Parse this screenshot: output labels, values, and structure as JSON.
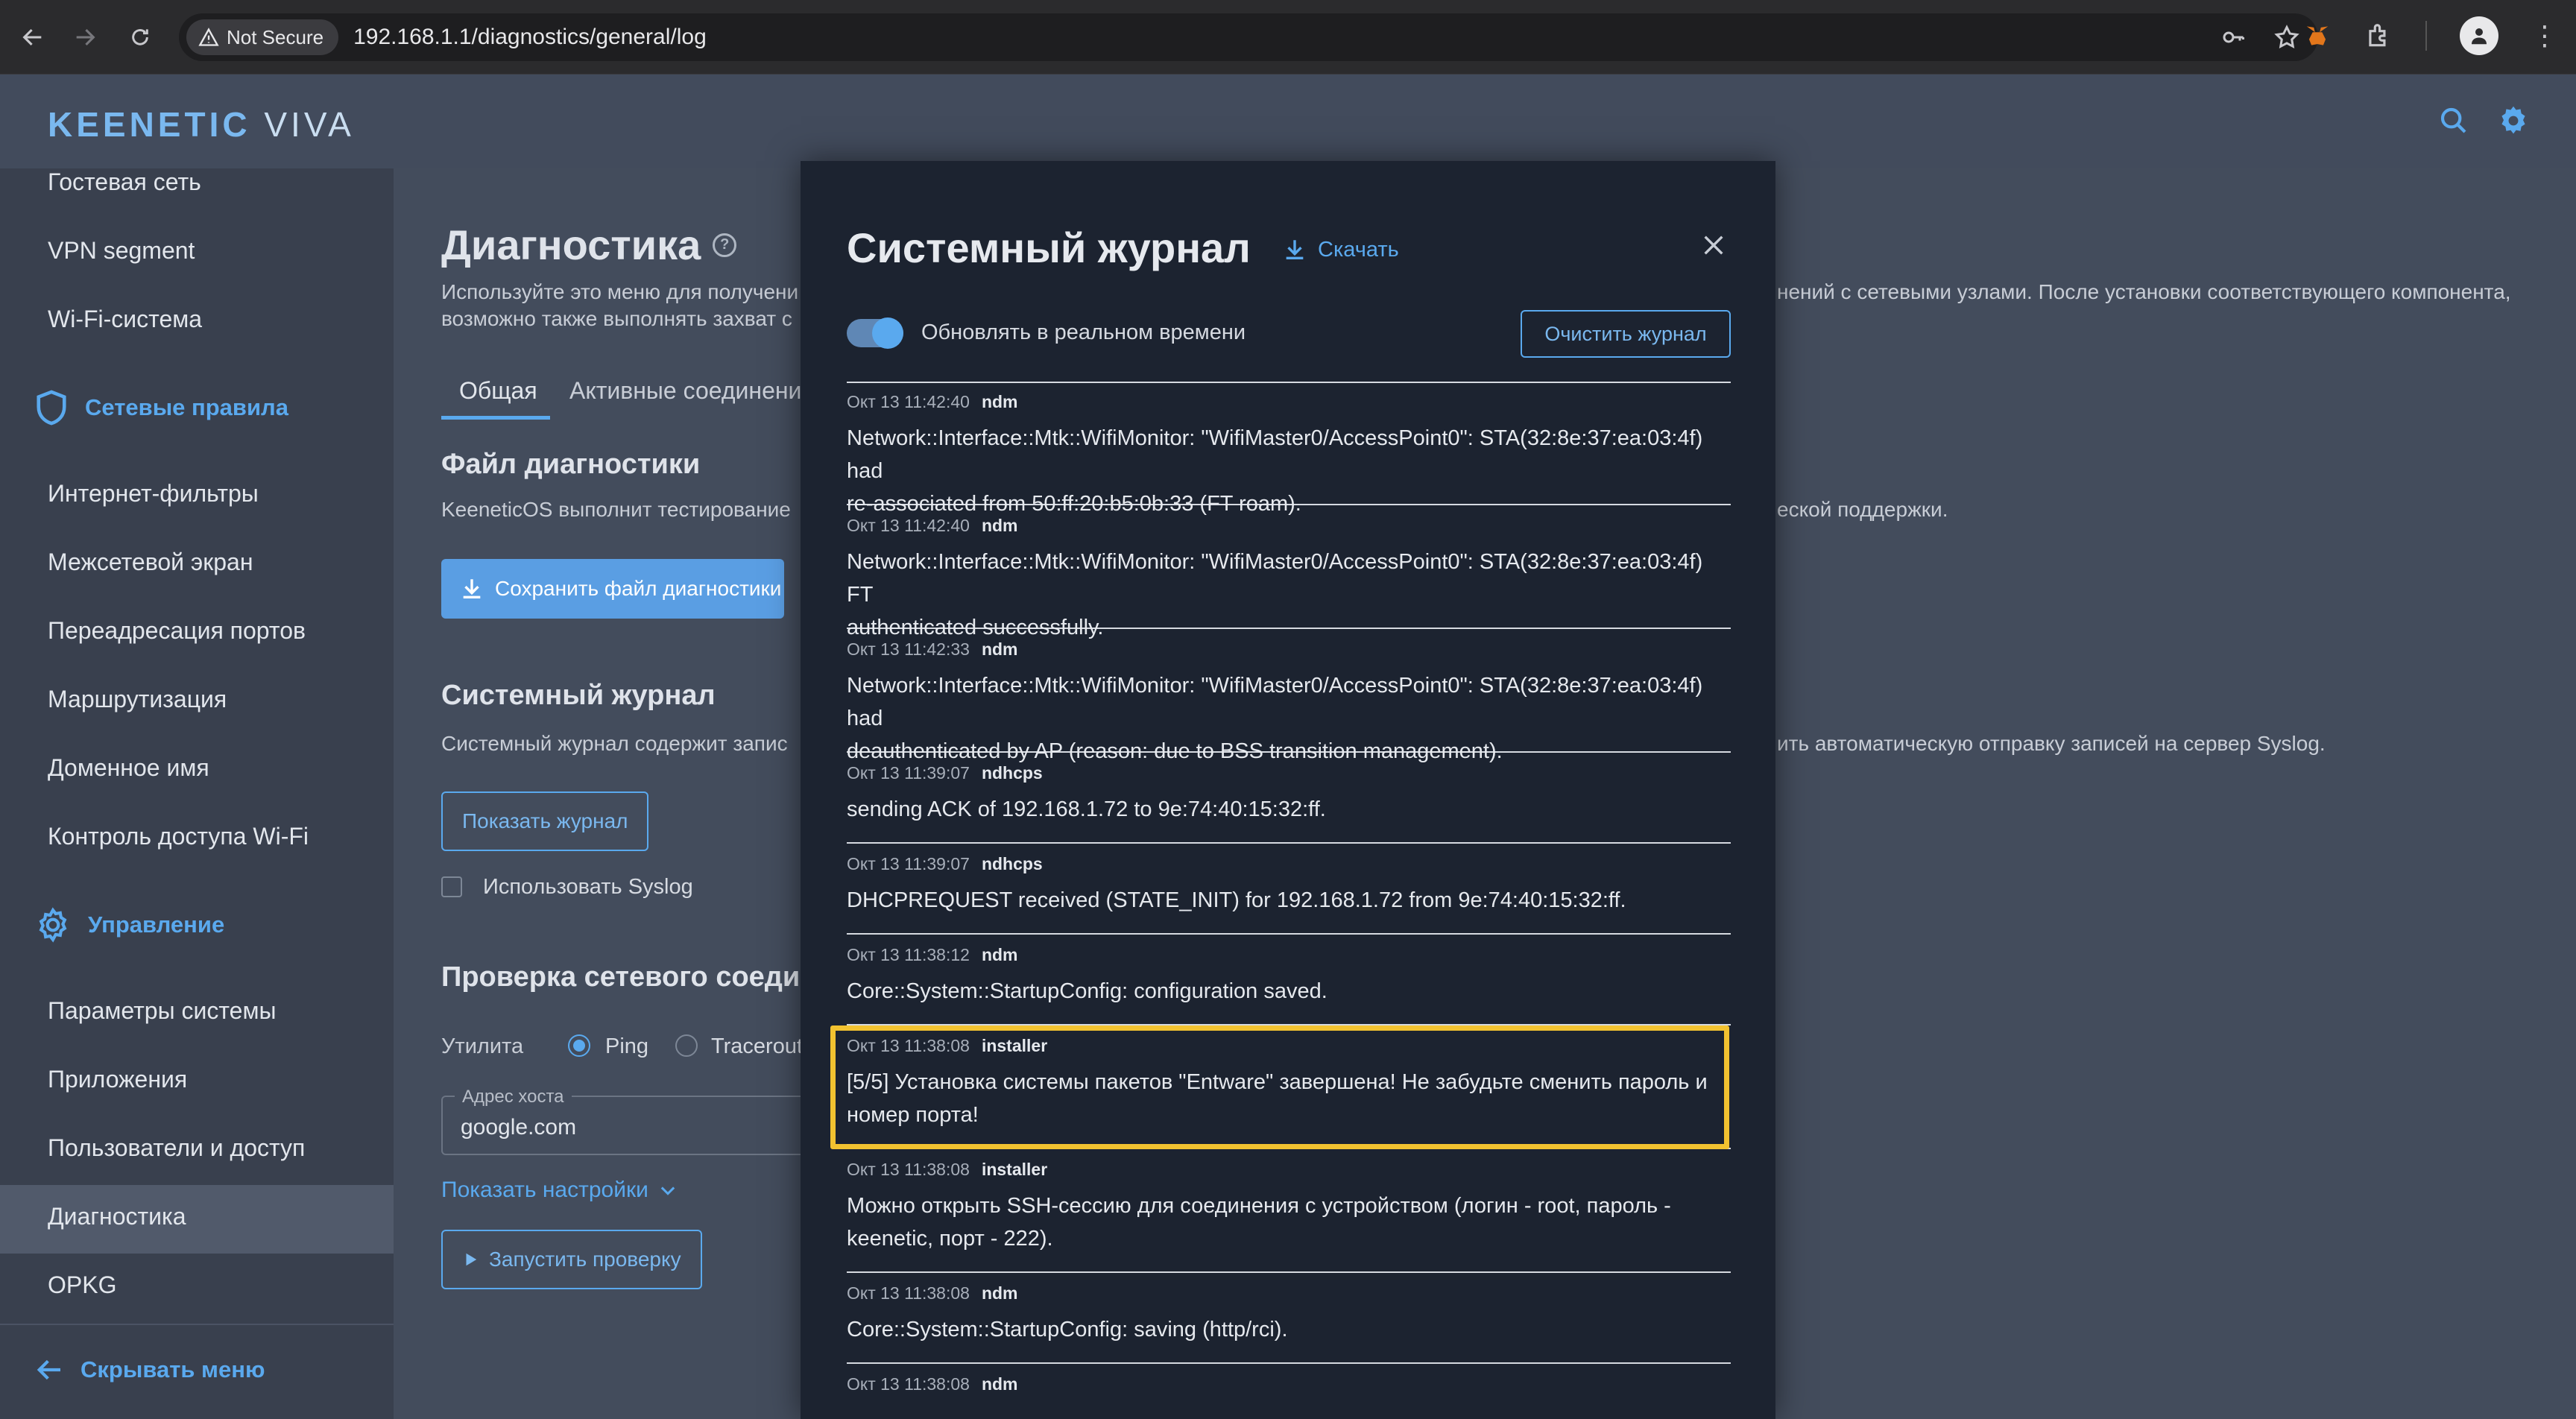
{
  "browser": {
    "security_label": "Not Secure",
    "url": "192.168.1.1/diagnostics/general/log"
  },
  "app": {
    "brand": "KEENETIC",
    "model": "VIVA"
  },
  "sidebar": {
    "items_top": [
      "Гостевая сеть",
      "VPN segment",
      "Wi-Fi-система"
    ],
    "section1": "Сетевые правила",
    "items_rules": [
      "Интернет-фильтры",
      "Межсетевой экран",
      "Переадресация портов",
      "Маршрутизация",
      "Доменное имя",
      "Контроль доступа Wi-Fi"
    ],
    "section2": "Управление",
    "items_manage": [
      "Параметры системы",
      "Приложения",
      "Пользователи и доступ",
      "Диагностика",
      "OPKG"
    ],
    "active_item": "Диагностика",
    "collapse_label": "Скрывать меню"
  },
  "main": {
    "title": "Диагностика",
    "intro_line1_left": "Используйте это меню для получени",
    "intro_line1_right": "нений с сетевыми узлами. После установки соответствующего компонента,",
    "intro_line2_left": "возможно также выполнять захват с",
    "tabs": [
      "Общая",
      "Активные соединени"
    ],
    "diag_file_title": "Файл диагностики",
    "diag_file_text_left": "KeeneticOS выполнит тестирование",
    "diag_file_text_right": "еской поддержки.",
    "save_diag_button": "Сохранить файл диагностики",
    "syslog_title": "Системный журнал",
    "syslog_text_left": "Системный журнал содержит запис",
    "syslog_text_right": "ить автоматическую отправку записей на сервер Syslog.",
    "show_log_button": "Показать журнал",
    "use_syslog_label": "Использовать Syslog",
    "network_check_title": "Проверка сетевого соеди",
    "utility_label": "Утилита",
    "ping_label": "Ping",
    "traceroute_label": "Tracerout",
    "host_label": "Адрес хоста",
    "host_value": "google.com",
    "show_settings_link": "Показать настройки",
    "run_check_button": "Запустить проверку"
  },
  "modal": {
    "title": "Системный журнал",
    "download_label": "Скачать",
    "realtime_label": "Обновлять в реальном времени",
    "realtime_on": true,
    "clear_button": "Очистить журнал",
    "entries": [
      {
        "time": "Окт 13 11:42:40",
        "src": "ndm",
        "line1": "Network::Interface::Mtk::WifiMonitor: \"WifiMaster0/AccessPoint0\": STA(32:8e:37:ea:03:4f) had",
        "line2": "re-associated from 50:ff:20:b5:0b:33 (FT roam)."
      },
      {
        "time": "Окт 13 11:42:40",
        "src": "ndm",
        "line1": "Network::Interface::Mtk::WifiMonitor: \"WifiMaster0/AccessPoint0\": STA(32:8e:37:ea:03:4f) FT",
        "line2": "authenticated successfully."
      },
      {
        "time": "Окт 13 11:42:33",
        "src": "ndm",
        "line1": "Network::Interface::Mtk::WifiMonitor: \"WifiMaster0/AccessPoint0\": STA(32:8e:37:ea:03:4f) had",
        "line2": "deauthenticated by AP (reason: due to BSS transition management)."
      },
      {
        "time": "Окт 13 11:39:07",
        "src": "ndhcps",
        "line1": "sending ACK of 192.168.1.72 to 9e:74:40:15:32:ff.",
        "line2": ""
      },
      {
        "time": "Окт 13 11:39:07",
        "src": "ndhcps",
        "line1": "DHCPREQUEST received (STATE_INIT) for 192.168.1.72 from 9e:74:40:15:32:ff.",
        "line2": ""
      },
      {
        "time": "Окт 13 11:38:12",
        "src": "ndm",
        "line1": "Core::System::StartupConfig: configuration saved.",
        "line2": ""
      },
      {
        "time": "Окт 13 11:38:08",
        "src": "installer",
        "line1": "[5/5] Установка системы пакетов \"Entware\" завершена! Не забудьте сменить пароль и",
        "line2": "номер порта!"
      },
      {
        "time": "Окт 13 11:38:08",
        "src": "installer",
        "line1": "Можно открыть SSH-сессию для соединения с устройством (логин - root, пароль -",
        "line2": "keenetic, порт - 222)."
      },
      {
        "time": "Окт 13 11:38:08",
        "src": "ndm",
        "line1": "Core::System::StartupConfig: saving (http/rci).",
        "line2": ""
      },
      {
        "time": "Окт 13 11:38:08",
        "src": "ndm",
        "line1": "",
        "line2": ""
      }
    ]
  },
  "colors": {
    "accent": "#5aa9ee",
    "highlight": "#f2c230",
    "modal_bg": "#1c2330"
  }
}
